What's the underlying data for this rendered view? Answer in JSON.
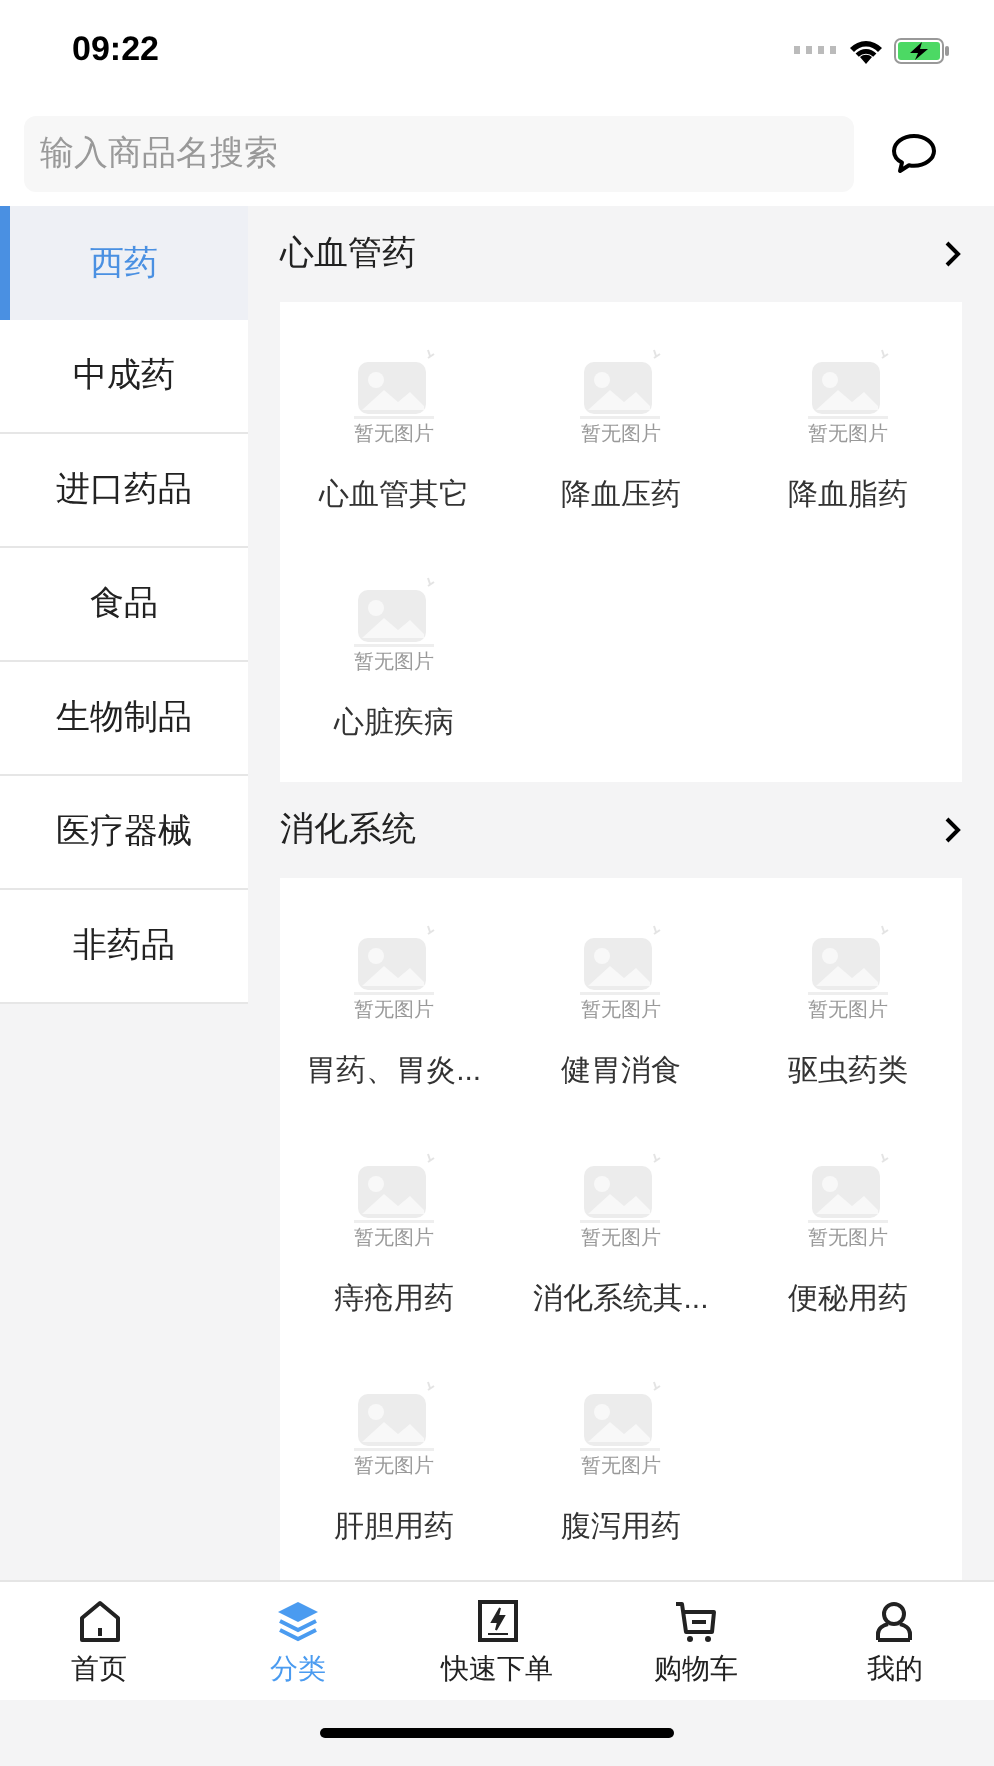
{
  "status_bar": {
    "time": "09:22"
  },
  "search": {
    "placeholder": "输入商品名搜索"
  },
  "sidebar": {
    "items": [
      {
        "label": "西药",
        "selected": true
      },
      {
        "label": "中成药",
        "selected": false
      },
      {
        "label": "进口药品",
        "selected": false
      },
      {
        "label": "食品",
        "selected": false
      },
      {
        "label": "生物制品",
        "selected": false
      },
      {
        "label": "医疗器械",
        "selected": false
      },
      {
        "label": "非药品",
        "selected": false
      }
    ]
  },
  "sections": [
    {
      "title": "心血管药",
      "items": [
        {
          "caption": "暂无图片",
          "label": "心血管其它"
        },
        {
          "caption": "暂无图片",
          "label": "降血压药"
        },
        {
          "caption": "暂无图片",
          "label": "降血脂药"
        },
        {
          "caption": "暂无图片",
          "label": "心脏疾病"
        }
      ]
    },
    {
      "title": "消化系统",
      "items": [
        {
          "caption": "暂无图片",
          "label": "胃药、胃炎..."
        },
        {
          "caption": "暂无图片",
          "label": "健胃消食"
        },
        {
          "caption": "暂无图片",
          "label": "驱虫药类"
        },
        {
          "caption": "暂无图片",
          "label": "痔疮用药"
        },
        {
          "caption": "暂无图片",
          "label": "消化系统其..."
        },
        {
          "caption": "暂无图片",
          "label": "便秘用药"
        },
        {
          "caption": "暂无图片",
          "label": "肝胆用药"
        },
        {
          "caption": "暂无图片",
          "label": "腹泻用药"
        }
      ]
    }
  ],
  "tab_bar": [
    {
      "kind": "home",
      "label": "首页",
      "selected": false
    },
    {
      "kind": "category",
      "label": "分类",
      "selected": true
    },
    {
      "kind": "quick",
      "label": "快速下单",
      "selected": false
    },
    {
      "kind": "cart",
      "label": "购物车",
      "selected": false
    },
    {
      "kind": "me",
      "label": "我的",
      "selected": false
    }
  ]
}
